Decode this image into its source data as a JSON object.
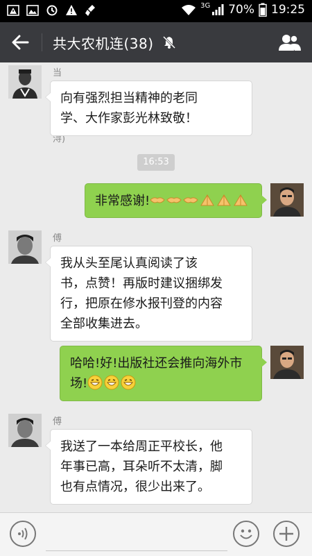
{
  "status_bar": {
    "network": "3G",
    "battery": "70%",
    "time": "19:25"
  },
  "header": {
    "title": "共大农机连(38)",
    "back_icon": "back-arrow-icon",
    "mute_icon": "muted-bell-icon",
    "members_icon": "group-members-icon"
  },
  "messages": [
    {
      "sender": "当兵的人(高浔)",
      "text": "向有强烈担当精神的老同学、大作家彭光林致敬！",
      "lines": [
        "向有强烈担当精神的老同",
        "学、大作家彭光林致敬！"
      ]
    },
    {
      "timestamp": "16:53"
    },
    {
      "text": "非常感谢!",
      "emoji": [
        "handshake",
        "handshake",
        "handshake",
        "bow",
        "bow",
        "bow"
      ]
    },
    {
      "sender": "傅唯力",
      "text": "我从头至尾认真阅读了该书，点赞！再版时建议捆绑发行，把原在修水报刊登的内容全部收集进去。",
      "lines": [
        "我从头至尾认真阅读了该",
        "书，点赞！再版时建议捆绑发",
        "行，把原在修水报刊登的内容",
        "全部收集进去。"
      ]
    },
    {
      "text": "哈哈!好!出版社还会推向海外市场!",
      "lines": [
        "哈哈!好!出版社还会推向海外市",
        "场!"
      ],
      "emoji": [
        "grin",
        "grin",
        "grin"
      ]
    },
    {
      "sender": "傅唯力",
      "text": "我送了一本给周正平校长，他年事已高，耳朵听不太清，脚也有点情况，很少出来了。",
      "lines": [
        "我送了一本给周正平校长，他",
        "年事已高，耳朵听不太清，脚",
        "也有点情况，很少出来了。"
      ]
    }
  ],
  "input_bar": {
    "voice_icon": "voice-icon",
    "emoji_icon": "emoji-icon",
    "plus_icon": "plus-icon",
    "input_value": ""
  }
}
